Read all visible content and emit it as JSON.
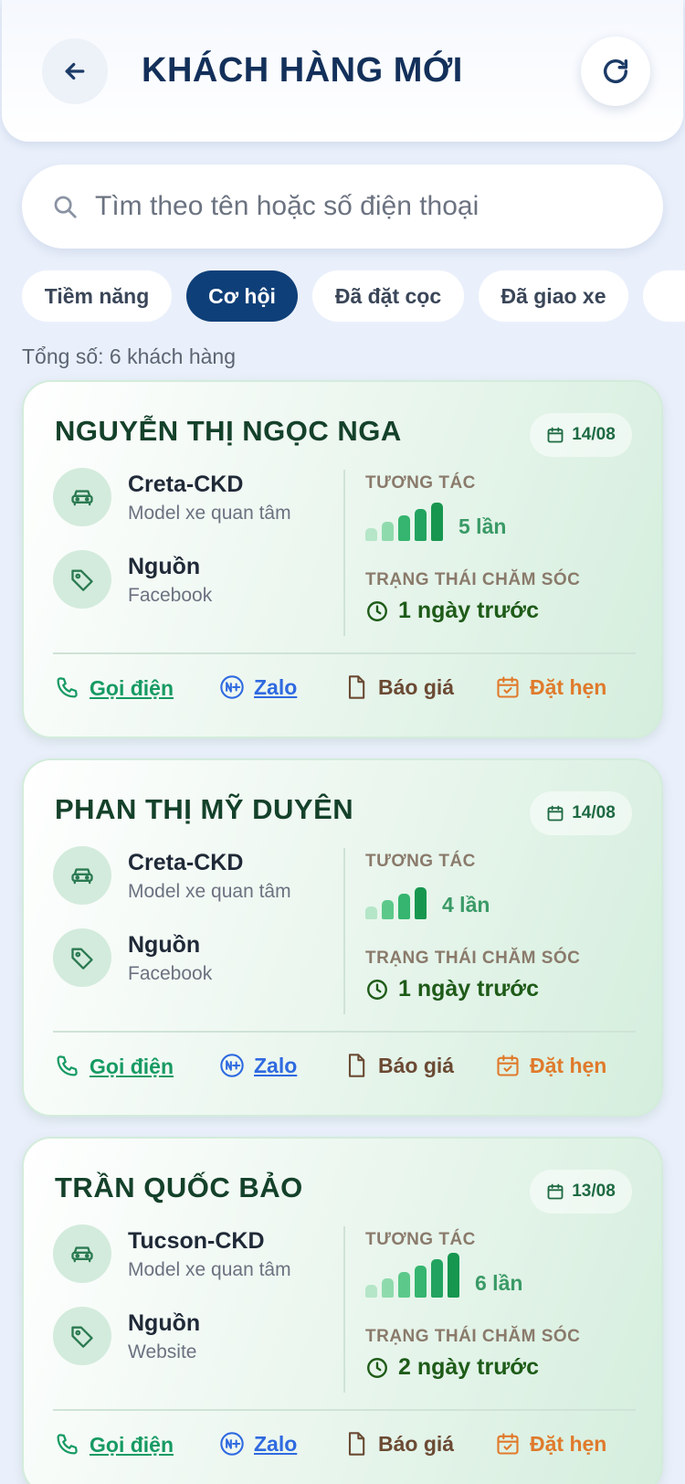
{
  "header": {
    "title": "KHÁCH HÀNG MỚI"
  },
  "search": {
    "placeholder": "Tìm theo tên hoặc số điện thoại"
  },
  "filters": [
    "Tiềm năng",
    "Cơ hội",
    "Đã đặt cọc",
    "Đã giao xe"
  ],
  "active_filter": "Cơ hội",
  "total": "Tổng số: 6 khách hàng",
  "labels": {
    "model_sub": "Model xe quan tâm",
    "source_title": "Nguồn",
    "interaction": "TƯƠNG TÁC",
    "care_status": "TRẠNG THÁI CHĂM SÓC"
  },
  "actions": {
    "call": "Gọi điện",
    "zalo": "Zalo",
    "quote": "Báo giá",
    "book": "Đặt hẹn"
  },
  "customers": [
    {
      "name": "NGUYỄN THỊ NGỌC NGA",
      "date": "14/08",
      "model": "Creta-CKD",
      "source": "Facebook",
      "interactions": 5,
      "interaction_text": "5 lần",
      "last_care": "1 ngày trước"
    },
    {
      "name": "PHAN THỊ MỸ DUYÊN",
      "date": "14/08",
      "model": "Creta-CKD",
      "source": "Facebook",
      "interactions": 4,
      "interaction_text": "4 lần",
      "last_care": "1 ngày trước"
    },
    {
      "name": "TRẦN QUỐC BẢO",
      "date": "13/08",
      "model": "Tucson-CKD",
      "source": "Website",
      "interactions": 6,
      "interaction_text": "6 lần",
      "last_care": "2 ngày trước"
    }
  ],
  "colors": {
    "primary": "#0f3f78",
    "bar_shades": [
      "#b5e6c8",
      "#8fdaad",
      "#5cc98a",
      "#35b56f",
      "#22a35f",
      "#17964f"
    ]
  }
}
